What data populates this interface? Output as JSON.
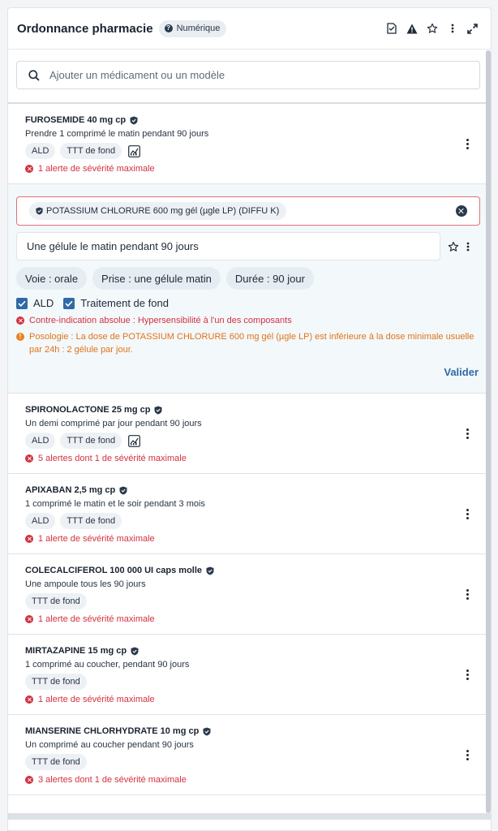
{
  "header": {
    "title": "Ordonnance pharmacie",
    "mode_badge": "Numérique",
    "actions": [
      "document-sign-icon",
      "warning-icon",
      "star-icon",
      "more-vertical-icon",
      "expand-icon"
    ]
  },
  "search": {
    "placeholder": "Ajouter un médicament ou un modèle"
  },
  "meds_top": [
    {
      "name": "FUROSEMIDE 40 mg cp",
      "posology": "Prendre 1 comprimé le matin pendant 90 jours",
      "tags": [
        "ALD",
        "TTT de fond"
      ],
      "chart": true,
      "alert": "1 alerte de sévérité maximale"
    }
  ],
  "editor": {
    "drug": "POTASSIUM CHLORURE 600 mg gél (µgle LP) (DIFFU K)",
    "posology_value": "Une gélule le matin pendant 90 jours",
    "pills": [
      "Voie : orale",
      "Prise : une gélule matin",
      "Durée : 90 jour"
    ],
    "checks": [
      "ALD",
      "Traitement de fond"
    ],
    "alert_red": "Contre-indication absolue : Hypersensibilité à l'un des composants",
    "alert_orange": "Posologie : La dose de POTASSIUM CHLORURE 600 mg gél (µgle LP) est inférieure à la dose minimale usuelle par 24h : 2 gélule par jour.",
    "validate": "Valider"
  },
  "meds": [
    {
      "name": "SPIRONOLACTONE 25 mg cp",
      "posology": "Un  demi comprimé par jour pendant 90 jours",
      "tags": [
        "ALD",
        "TTT de fond"
      ],
      "chart": true,
      "alert": "5 alertes dont 1 de sévérité maximale"
    },
    {
      "name": "APIXABAN 2,5 mg cp",
      "posology": "1 comprimé le matin et le soir  pendant 3 mois",
      "tags": [
        "ALD",
        "TTT de fond"
      ],
      "chart": false,
      "alert": "1 alerte de sévérité maximale"
    },
    {
      "name": "COLECALCIFEROL 100 000 UI caps molle",
      "posology": "Une ampoule tous les 90 jours",
      "tags": [
        "TTT de fond"
      ],
      "chart": false,
      "alert": "1 alerte de sévérité maximale"
    },
    {
      "name": "MIRTAZAPINE 15 mg cp",
      "posology": "1 comprimé au coucher, pendant 90 jours",
      "tags": [
        "TTT de fond"
      ],
      "chart": false,
      "alert": "1 alerte de sévérité maximale"
    },
    {
      "name": "MIANSERINE CHLORHYDRATE 10 mg cp",
      "posology": "Un comprimé au coucher pendant 90 jours",
      "tags": [
        "TTT de fond"
      ],
      "chart": false,
      "alert": "3 alertes dont 1 de sévérité maximale"
    }
  ],
  "colors": {
    "accent": "#2f6aa6",
    "alert_red": "#d4303f",
    "alert_orange": "#e07418",
    "editor_bg": "#f3f8fb"
  }
}
